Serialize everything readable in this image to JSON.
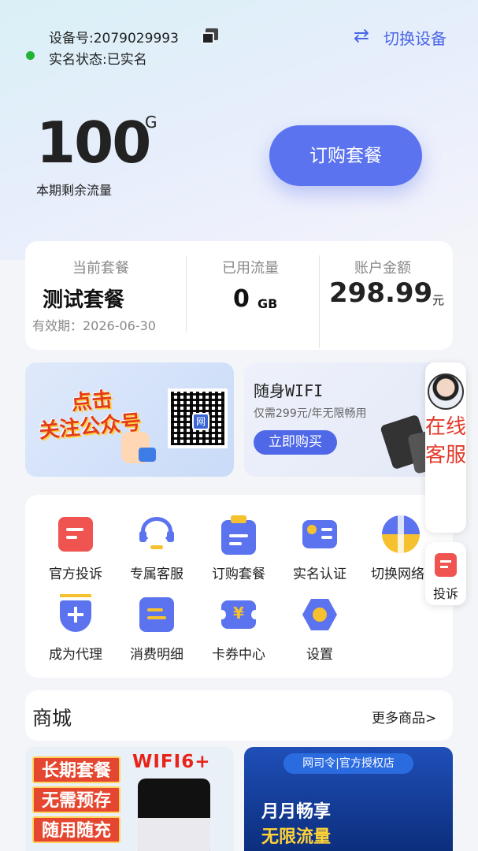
{
  "header": {
    "device_label": "设备号:2079029993",
    "realname_label": "实名状态:已实名",
    "switch_device": "切换设备",
    "status_color": "#21b336",
    "accent": "#4a66e6"
  },
  "traffic": {
    "remaining": "100",
    "unit": "G",
    "remaining_label": "本期剩余流量",
    "order_button": "订购套餐"
  },
  "summary": {
    "plan_label": "当前套餐",
    "plan_name": "测试套餐",
    "plan_expiry": "有效期：2026-06-30",
    "used_label": "已用流量",
    "used_value": "0",
    "used_unit": "GB",
    "balance_label": "账户金额",
    "balance_value": "298.99",
    "balance_unit": "元"
  },
  "promo_follow": {
    "text_line1": "点击",
    "text_line2": "关注公众号",
    "qr_center": "网"
  },
  "promo_wifi": {
    "title": "随身WIFI",
    "subtitle": "仅需299元/年无限畅用",
    "button": "立即购买"
  },
  "services": [
    {
      "label": "官方投诉",
      "icon": "complaint-icon"
    },
    {
      "label": "专属客服",
      "icon": "headset-icon"
    },
    {
      "label": "订购套餐",
      "icon": "clipboard-icon"
    },
    {
      "label": "实名认证",
      "icon": "id-card-icon"
    },
    {
      "label": "切换网络",
      "icon": "globe-icon"
    },
    {
      "label": "成为代理",
      "icon": "shield-plus-icon"
    },
    {
      "label": "消费明细",
      "icon": "bill-icon"
    },
    {
      "label": "卡券中心",
      "icon": "coupon-icon"
    },
    {
      "label": "设置",
      "icon": "settings-icon"
    }
  ],
  "floating": {
    "service_text": "在线客服",
    "complaint_text": "投诉"
  },
  "shop": {
    "title": "商城",
    "more": "更多商品>",
    "banner1": {
      "tags": [
        "长期套餐",
        "无需预存",
        "随用随充"
      ],
      "brand": "WIFI6+"
    },
    "banner2": {
      "tag": "网司令|官方授权店",
      "line1": "月月畅享",
      "line2": "无限流量"
    }
  }
}
